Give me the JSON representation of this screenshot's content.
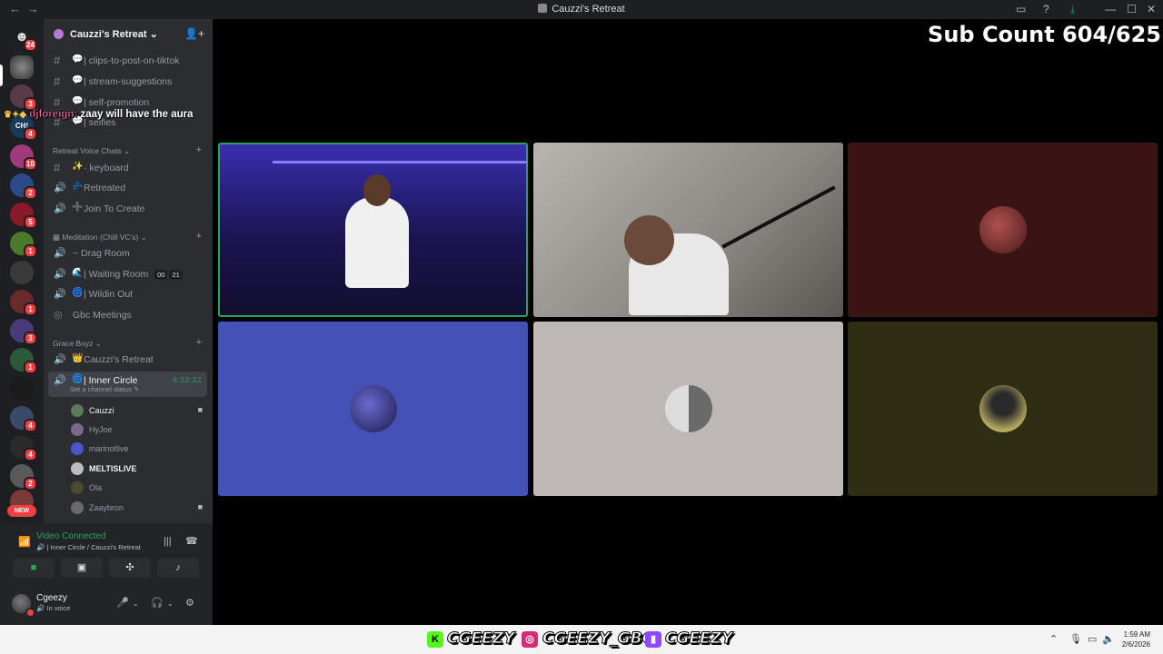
{
  "window": {
    "title": "Cauzzi's Retreat",
    "back_icon": "arrow-left-icon",
    "forward_icon": "arrow-right-icon"
  },
  "servers": {
    "home_badge": "24",
    "badges": [
      "",
      "3",
      "",
      "4",
      "10",
      "2",
      "5",
      "1",
      "",
      "1",
      "3",
      "1",
      "",
      "4",
      "4",
      "2"
    ],
    "new_label": "NEW"
  },
  "guild": {
    "name": "Cauzzi's Retreat"
  },
  "channels": {
    "text": [
      {
        "emoji": "💬",
        "name": "| clips-to-post-on-tiktok"
      },
      {
        "emoji": "💬",
        "name": "| stream-suggestions"
      },
      {
        "emoji": "💬",
        "name": "| self-promotion"
      },
      {
        "emoji": "💬",
        "name": "| selfies"
      }
    ],
    "categories": [
      {
        "name": "Retreat Voice Chats"
      },
      {
        "name": "Meditation (Chill VC's)"
      },
      {
        "name": "Grace Boyz"
      }
    ],
    "retreat_voice": [
      {
        "emoji": "✨",
        "name": "· keyboard",
        "type": "text"
      },
      {
        "emoji": "💤",
        "name": "Retreated",
        "type": "voice"
      },
      {
        "emoji": "➕",
        "name": "Join To Create",
        "type": "voice"
      }
    ],
    "meditation": [
      {
        "emoji": "",
        "name": "~ Drag Room",
        "type": "voice"
      },
      {
        "emoji": "🌊",
        "name": "| Waiting Room",
        "type": "voice",
        "count_a": "00",
        "count_b": "21"
      },
      {
        "emoji": "🌀",
        "name": "| Wildin Out",
        "type": "voice"
      },
      {
        "emoji": "",
        "name": "Gbc Meetings",
        "type": "stage"
      }
    ],
    "grace_boyz": [
      {
        "emoji": "👑",
        "name": "Cauzzi's Retreat",
        "type": "voice"
      }
    ],
    "active": {
      "emoji": "🌀",
      "name": "| Inner Circle",
      "timer": "6:32:22",
      "status": "Set a channel status"
    },
    "members": [
      {
        "name": "Cauzzi",
        "highlight": true,
        "camera": true,
        "color": "#5a7a5a"
      },
      {
        "name": "HyJoe",
        "highlight": false,
        "camera": false,
        "color": "#7a6a8a"
      },
      {
        "name": "marinotlive",
        "highlight": false,
        "camera": false,
        "color": "#4b55c9"
      },
      {
        "name": "MELTISLIVE",
        "highlight": true,
        "camera": false,
        "color": "#bdbdbd"
      },
      {
        "name": "Ola",
        "highlight": false,
        "camera": false,
        "color": "#4a4a33"
      },
      {
        "name": "Zaaybron",
        "highlight": false,
        "camera": true,
        "color": "#6a6a6a"
      }
    ]
  },
  "voice_panel": {
    "title": "Video Connected",
    "subtitle": "| Inner Circle / Cauzzi's Retreat"
  },
  "user_panel": {
    "name": "Cgeezy",
    "status": "In voice"
  },
  "overlay": {
    "chat_user": "djforeign:",
    "chat_message": "zaay will have the aura",
    "sub_count": "Sub Count 604/625"
  },
  "video_tiles": [
    {
      "bg": "#2a1f6e",
      "avatar": false,
      "speaking": true,
      "label": "Cauzzi camera"
    },
    {
      "bg": "#8a8682",
      "avatar": false,
      "speaking": false,
      "label": "Zaaybron camera"
    },
    {
      "bg": "#3a1414",
      "avatar": true,
      "avatar_color": "#8a2a2a",
      "speaking": false
    },
    {
      "bg": "#4452b8",
      "avatar": true,
      "avatar_color": "#3a3a88",
      "speaking": false
    },
    {
      "bg": "#bdb8b6",
      "avatar": true,
      "avatar_color": "#9a9a9a",
      "speaking": false
    },
    {
      "bg": "#2f2d14",
      "avatar": true,
      "avatar_color": "#b5a860",
      "speaking": false
    }
  ],
  "social_bar": {
    "kick": "CGEEZY",
    "instagram": "CGEEZY_GBC",
    "twitch": "CGEEZY"
  },
  "taskbar": {
    "time": "1:59 AM",
    "date": "2/6/2026"
  },
  "colors": {
    "accent_green": "#23a55a",
    "sidebar_bg": "#2b2d31",
    "server_bg": "#1e1f22",
    "red_badge": "#f23f43"
  }
}
